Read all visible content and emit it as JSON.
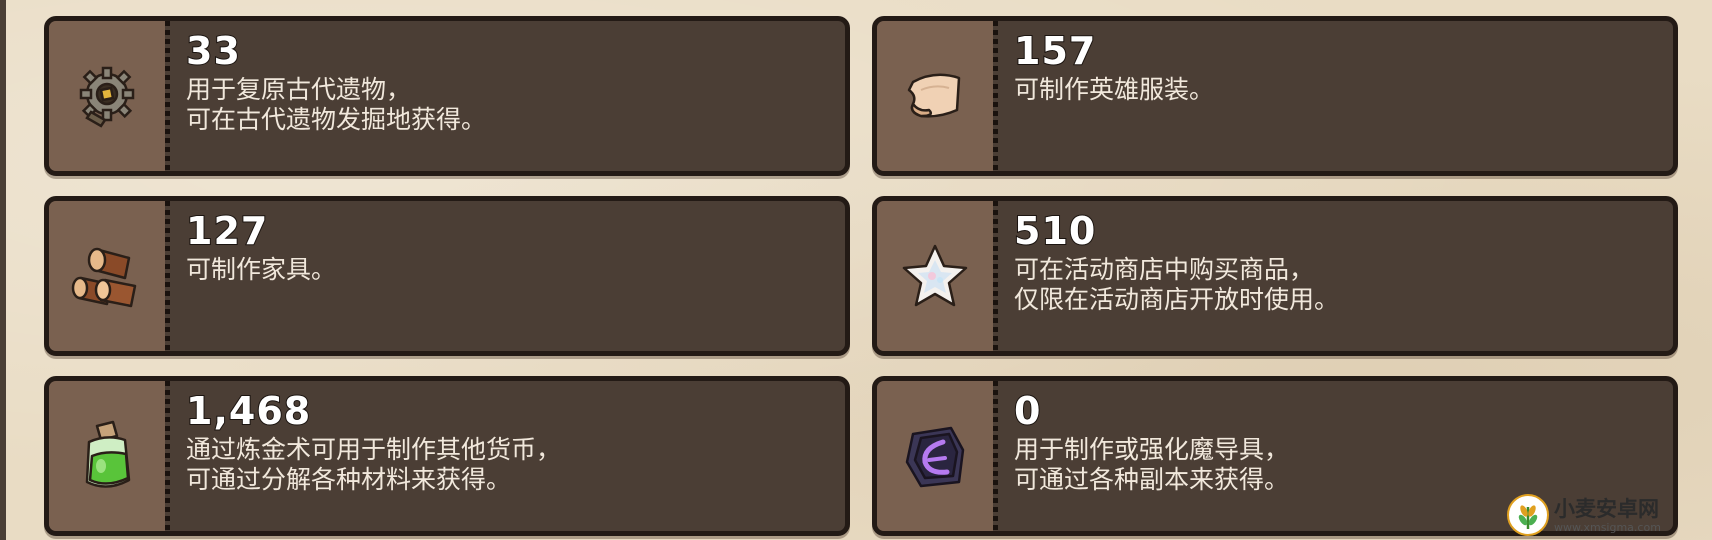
{
  "items": [
    {
      "icon": "gear-relic-icon",
      "count": "33",
      "description": "用于复原古代遗物，\n可在古代遗物发掘地获得。"
    },
    {
      "icon": "cloth-scroll-icon",
      "count": "157",
      "description": "可制作英雄服装。"
    },
    {
      "icon": "wood-logs-icon",
      "count": "127",
      "description": "可制作家具。"
    },
    {
      "icon": "crystal-star-icon",
      "count": "510",
      "description": "可在活动商店中购买商品，\n仅限在活动商店开放时使用。"
    },
    {
      "icon": "green-potion-icon",
      "count": "1,468",
      "description": "通过炼金术可用于制作其他货币，\n可通过分解各种材料来获得。"
    },
    {
      "icon": "dark-rune-stone-icon",
      "count": "0",
      "description": "用于制作或强化魔导具，\n可通过各种副本来获得。"
    }
  ],
  "watermark": {
    "title": "小麦安卓网",
    "url": "www.xmsigma.com"
  },
  "colors": {
    "card_bg": "#4b3e35",
    "icon_bg": "#7a6150",
    "border": "#231a15",
    "page_bg": "#e9dcc4"
  }
}
